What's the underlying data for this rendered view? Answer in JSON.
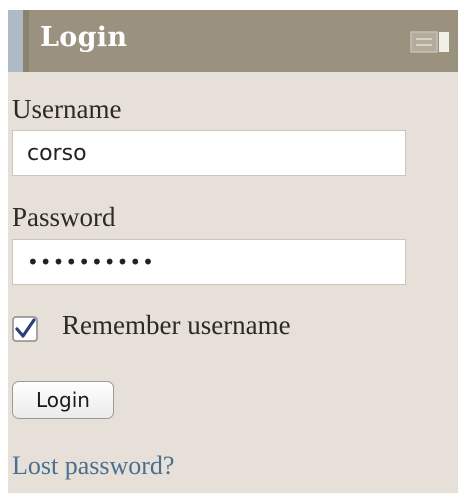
{
  "block": {
    "title": "Login",
    "username_label": "Username",
    "username_value": "corso",
    "password_label": "Password",
    "password_value": "••••••••••",
    "remember_checked": true,
    "remember_label": "Remember username",
    "login_button_label": "Login",
    "lost_password_link": "Lost password?"
  },
  "icons": {
    "collapse": "collapse-block-icon",
    "checkbox": "checkmark-icon"
  },
  "colors": {
    "header_background": "#9b917f",
    "block_background": "#e6e0d8",
    "link": "#4a6f8f"
  }
}
